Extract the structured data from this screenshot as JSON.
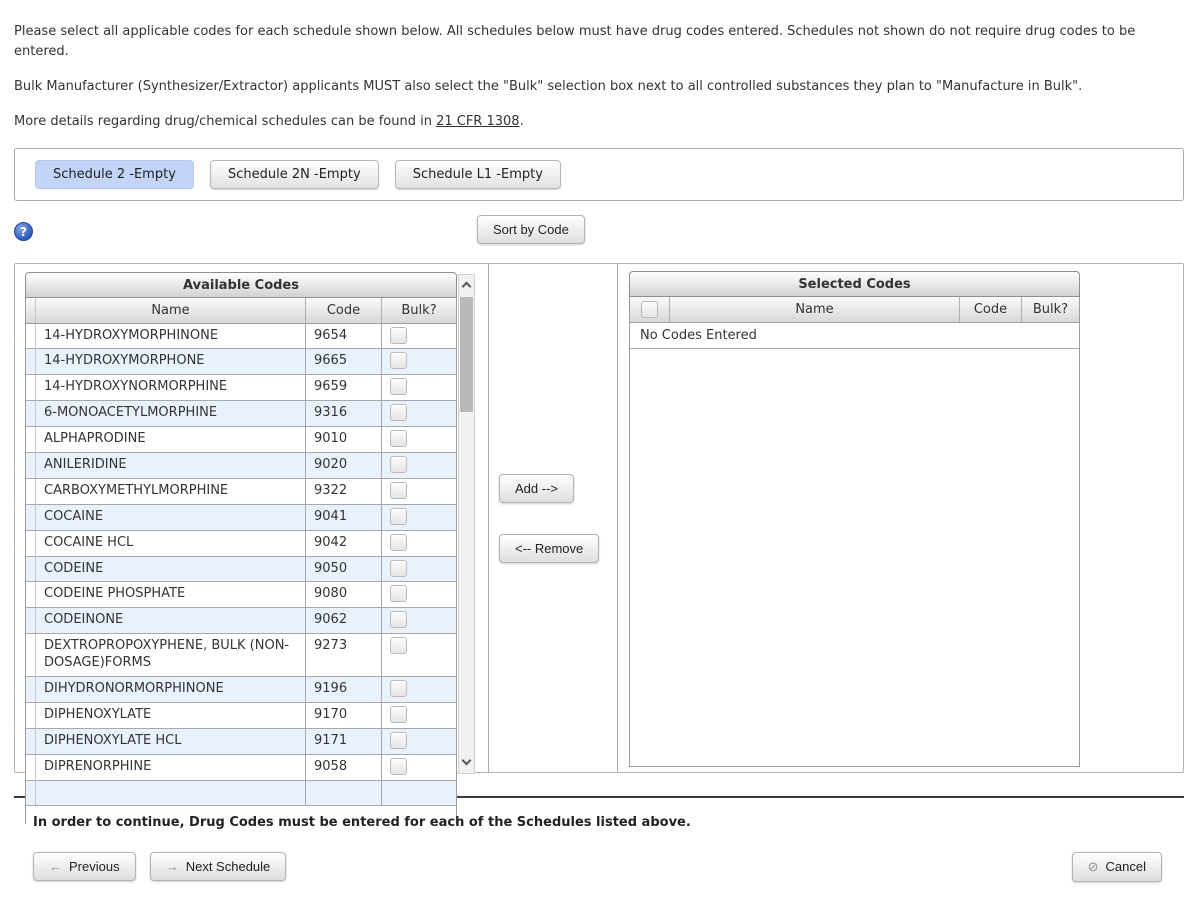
{
  "intro": {
    "paragraph1": "Please select all applicable codes for each schedule shown below. All schedules below must have drug codes entered. Schedules not shown do not require drug codes to be entered.",
    "paragraph2": "Bulk Manufacturer (Synthesizer/Extractor) applicants MUST also select the \"Bulk\" selection box next to all controlled substances they plan to \"Manufacture in Bulk\".",
    "paragraph3_prefix": "More details regarding drug/chemical schedules can be found in ",
    "paragraph3_link": "21 CFR 1308",
    "paragraph3_suffix": "."
  },
  "schedule_tabs": [
    {
      "label": "Schedule 2 -Empty",
      "selected": true
    },
    {
      "label": "Schedule 2N -Empty",
      "selected": false
    },
    {
      "label": "Schedule L1 -Empty",
      "selected": false
    }
  ],
  "toolbar": {
    "help_icon": "question-mark-icon",
    "help_glyph": "?",
    "sort_button_label": "Sort by Code"
  },
  "available_codes": {
    "title": "Available Codes",
    "columns": {
      "name": "Name",
      "code": "Code",
      "bulk": "Bulk?"
    },
    "rows": [
      {
        "name": "14-HYDROXYMORPHINONE",
        "code": "9654",
        "bulk": false
      },
      {
        "name": "14-HYDROXYMORPHONE",
        "code": "9665",
        "bulk": false
      },
      {
        "name": "14-HYDROXYNORMORPHINE",
        "code": "9659",
        "bulk": false
      },
      {
        "name": "6-MONOACETYLMORPHINE",
        "code": "9316",
        "bulk": false
      },
      {
        "name": "ALPHAPRODINE",
        "code": "9010",
        "bulk": false
      },
      {
        "name": "ANILERIDINE",
        "code": "9020",
        "bulk": false
      },
      {
        "name": "CARBOXYMETHYLMORPHINE",
        "code": "9322",
        "bulk": false
      },
      {
        "name": "COCAINE",
        "code": "9041",
        "bulk": false
      },
      {
        "name": "COCAINE HCL",
        "code": "9042",
        "bulk": false
      },
      {
        "name": "CODEINE",
        "code": "9050",
        "bulk": false
      },
      {
        "name": "CODEINE PHOSPHATE",
        "code": "9080",
        "bulk": false
      },
      {
        "name": "CODEINONE",
        "code": "9062",
        "bulk": false
      },
      {
        "name": "DEXTROPROPOXYPHENE, BULK (NON-DOSAGE)FORMS",
        "code": "9273",
        "bulk": false
      },
      {
        "name": "DIHYDRONORMORPHINONE",
        "code": "9196",
        "bulk": false
      },
      {
        "name": "DIPHENOXYLATE",
        "code": "9170",
        "bulk": false
      },
      {
        "name": "DIPHENOXYLATE HCL",
        "code": "9171",
        "bulk": false
      },
      {
        "name": "DIPRENORPHINE",
        "code": "9058",
        "bulk": false
      }
    ]
  },
  "transfer_buttons": {
    "add_label": "Add -->",
    "remove_label": "<-- Remove"
  },
  "selected_codes": {
    "title": "Selected Codes",
    "columns": {
      "name": "Name",
      "code": "Code",
      "bulk": "Bulk?"
    },
    "header_checkbox_checked": false,
    "empty_message": "No Codes Entered"
  },
  "footer": {
    "notice": "In order to continue, Drug Codes must be entered for each of the Schedules listed above.",
    "previous_label": "Previous",
    "previous_icon": "left-arrow-icon",
    "previous_glyph": "←",
    "next_label": "Next Schedule",
    "next_icon": "right-arrow-icon",
    "next_glyph": "→",
    "cancel_label": "Cancel",
    "cancel_icon": "no-entry-icon",
    "cancel_glyph": "⊘"
  },
  "colors": {
    "selected_tab_bg": "#c2d4f8",
    "alt_row_bg": "#e9f2fc",
    "link_color": "#333333"
  }
}
